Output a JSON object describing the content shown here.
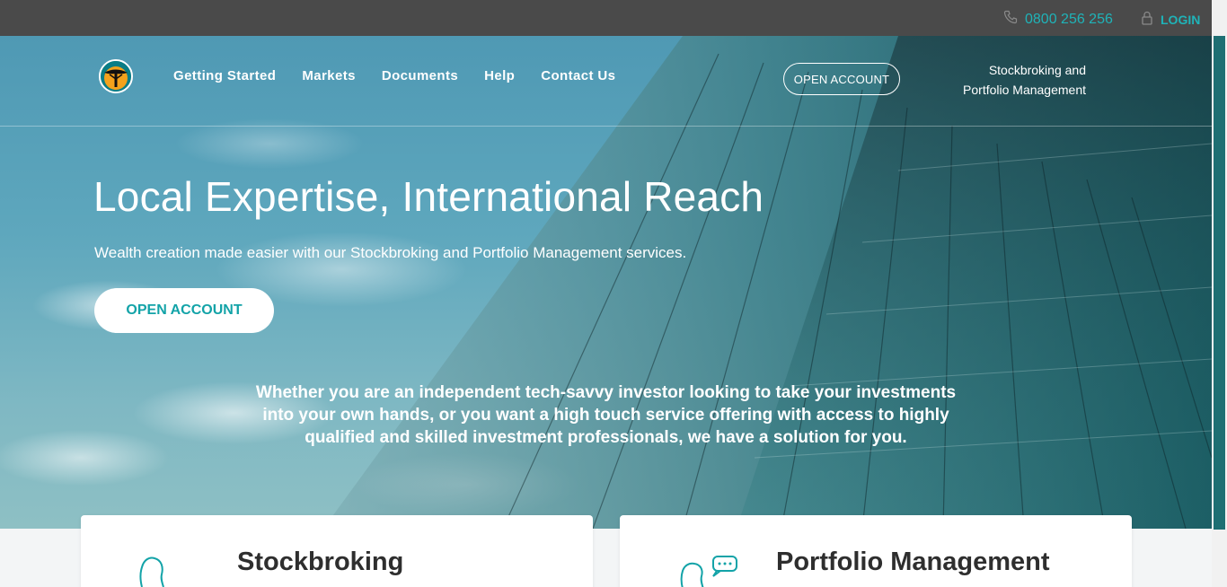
{
  "topbar": {
    "phone": "0800 256 256",
    "login": "LOGIN",
    "phone_icon": "phone-icon",
    "lock_icon": "lock-icon"
  },
  "header": {
    "logo": "tree-logo-icon",
    "nav": [
      "Getting Started",
      "Markets",
      "Documents",
      "Help",
      "Contact Us"
    ],
    "open_account": "OPEN ACCOUNT",
    "tagline_line1": "Stockbroking and",
    "tagline_line2": "Portfolio Management"
  },
  "hero": {
    "title": "Local Expertise, International Reach",
    "subtitle": "Wealth creation made easier with our Stockbroking and Portfolio Management services.",
    "cta": "OPEN ACCOUNT",
    "lead": "Whether you are an independent tech-savvy investor looking to take your investments into your own hands, or you want a high touch service offering with access to highly qualified and skilled investment professionals, we have a solution for you."
  },
  "cards": [
    {
      "title": "Stockbroking",
      "icon": "person-icon"
    },
    {
      "title": "Portfolio Management",
      "icon": "person-chat-icon"
    }
  ],
  "colors": {
    "accent": "#1fb3b8",
    "topbar": "#4a4a4a",
    "card_title": "#2e2e2e"
  }
}
